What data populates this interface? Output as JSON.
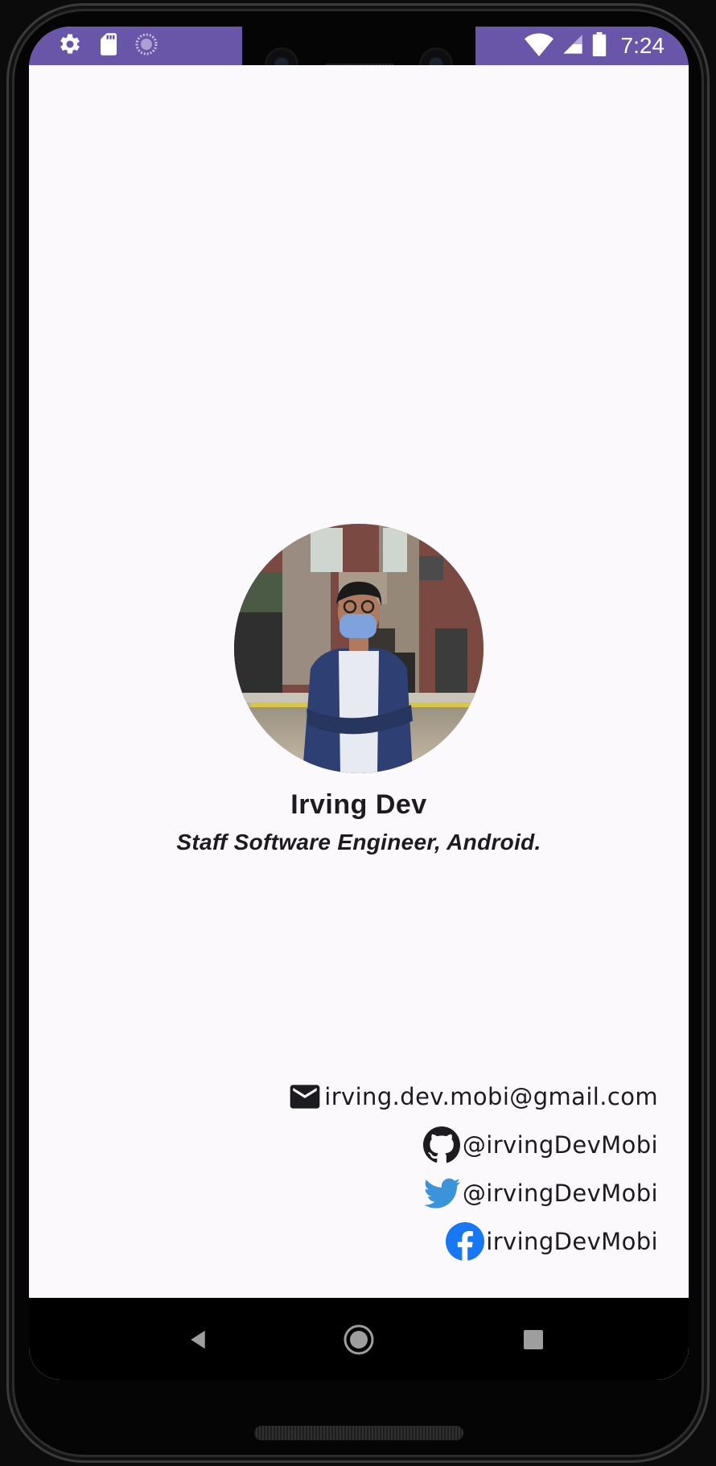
{
  "status_bar": {
    "time": "7:24",
    "background": "#6a56a9",
    "left_icons": [
      "gear-icon",
      "sd-card-icon",
      "loading-icon"
    ],
    "right_icons": [
      "wifi-icon",
      "cell-signal-icon",
      "battery-icon"
    ]
  },
  "profile": {
    "avatar_alt": "profile-photo",
    "name": "Irving Dev",
    "title": "Staff Software Engineer, Android."
  },
  "contacts": [
    {
      "icon": "email-icon",
      "text": "irving.dev.mobi@gmail.com"
    },
    {
      "icon": "github-icon",
      "text": "@irvingDevMobi"
    },
    {
      "icon": "twitter-icon",
      "text": "@irvingDevMobi"
    },
    {
      "icon": "facebook-icon",
      "text": "irvingDevMobi"
    }
  ],
  "nav_bar": {
    "buttons": [
      "back-button",
      "home-button",
      "recents-button"
    ]
  },
  "colors": {
    "screen_background": "#fcf9fd",
    "text": "#1c1b1f",
    "twitter": "#1d9bf0",
    "facebook": "#1877f2"
  }
}
